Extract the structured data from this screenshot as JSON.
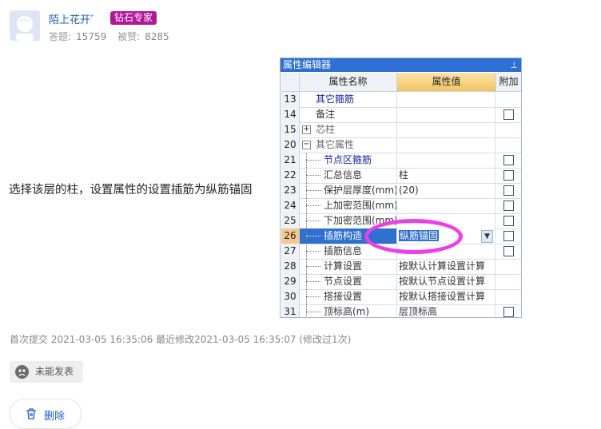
{
  "user": {
    "name": "陌上花开゛",
    "badge": "钻石专家",
    "answers_label": "答题:",
    "answers": "15759",
    "likes_label": "被赞:",
    "likes": "8285"
  },
  "post": {
    "text": "选择该层的柱，设置属性的设置插筋为纵筋锚固",
    "meta": "首次提交 2021-03-05 16:35:06 最近修改2021-03-05 16:35:07 (修改过1次)",
    "cannot_post_label": "未能发表",
    "delete_label": "删除"
  },
  "editor": {
    "title": "属性编辑器",
    "headers": {
      "name": "属性名称",
      "value": "属性值",
      "add": "附加"
    },
    "rows": [
      {
        "num": "13",
        "name": "其它箍筋",
        "value": "",
        "check": false
      },
      {
        "num": "14",
        "name": "备注",
        "value": "",
        "check": true
      },
      {
        "num": "15",
        "name": "芯柱",
        "value": "",
        "check": false
      },
      {
        "num": "20",
        "name": "其它属性",
        "value": "",
        "check": false
      },
      {
        "num": "21",
        "name": "节点区箍筋",
        "value": "",
        "check": true
      },
      {
        "num": "22",
        "name": "汇总信息",
        "value": "柱",
        "check": true
      },
      {
        "num": "23",
        "name": "保护层厚度(mm)",
        "value": "(20)",
        "check": true
      },
      {
        "num": "24",
        "name": "上加密范围(mm)",
        "value": "",
        "check": true
      },
      {
        "num": "25",
        "name": "下加密范围(mm)",
        "value": "",
        "check": true
      },
      {
        "num": "26",
        "name": "插筋构造",
        "value": "纵筋锚固",
        "check": true
      },
      {
        "num": "27",
        "name": "插筋信息",
        "value": "",
        "check": true
      },
      {
        "num": "28",
        "name": "计算设置",
        "value": "按默认计算设置计算",
        "check": false
      },
      {
        "num": "29",
        "name": "节点设置",
        "value": "按默认节点设置计算",
        "check": false
      },
      {
        "num": "30",
        "name": "搭接设置",
        "value": "按默认搭接设置计算",
        "check": false
      },
      {
        "num": "31",
        "name": "顶标高(m)",
        "value": "层顶标高",
        "check": true
      }
    ]
  },
  "colors": {
    "link": "#1f5bbf",
    "badge": "#b3169a",
    "highlight_ellipse": "#ee3ee6",
    "selection": "#2f6fce"
  }
}
